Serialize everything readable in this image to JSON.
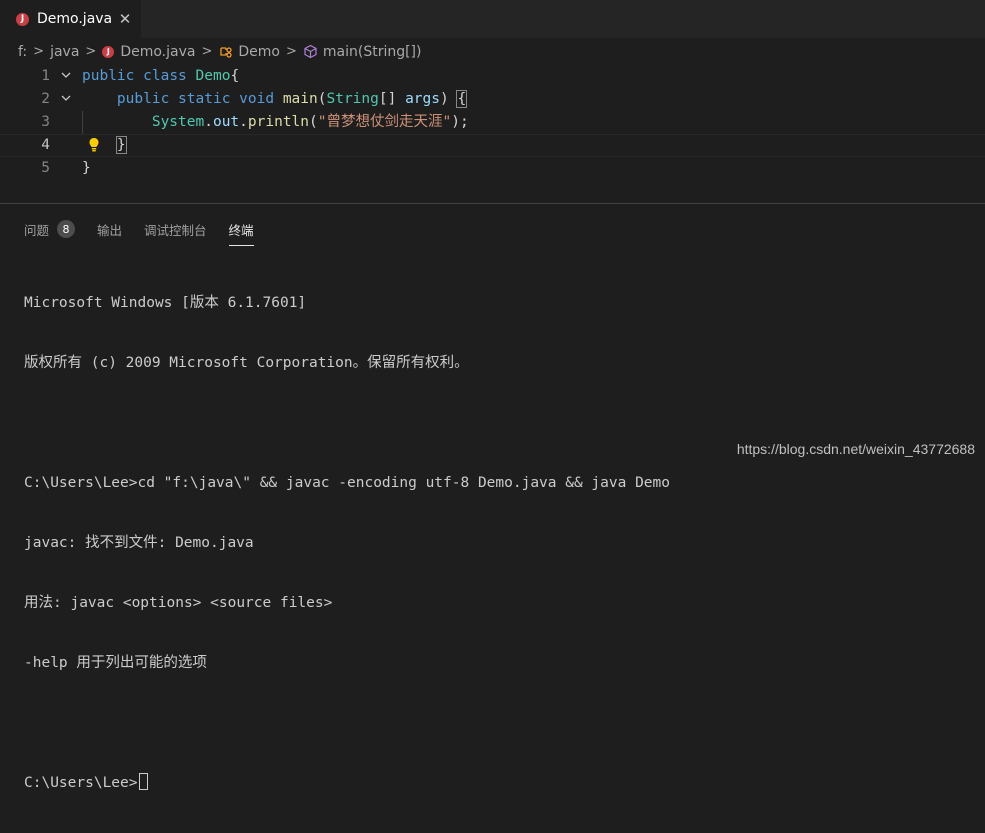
{
  "tab": {
    "filename": "Demo.java",
    "icon_letter": "J",
    "close_glyph": "✕"
  },
  "breadcrumb": {
    "drive": "f:",
    "folder": "java",
    "file": "Demo.java",
    "class": "Demo",
    "method": "main(String[])"
  },
  "editor": {
    "lines": [
      {
        "num": "1",
        "code_kw1": "public",
        "code_kw2": "class",
        "code_cls": "Demo",
        "code_brace": "{"
      },
      {
        "num": "2",
        "kw1": "public",
        "kw2": "static",
        "kw3": "void",
        "fn": "main",
        "p1": "(",
        "ty": "String",
        "p2": "[] ",
        "var": "args",
        "p3": ") ",
        "brace": "{"
      },
      {
        "num": "3",
        "cls": "System",
        "d1": ".",
        "field": "out",
        "d2": ".",
        "fn": "println",
        "p1": "(",
        "str": "\"曾梦想仗剑走天涯\"",
        "p2": ");"
      },
      {
        "num": "4",
        "brace": "}"
      },
      {
        "num": "5",
        "brace": "}"
      }
    ]
  },
  "panel": {
    "tabs": [
      {
        "label": "问题",
        "badge": "8"
      },
      {
        "label": "输出"
      },
      {
        "label": "调试控制台"
      },
      {
        "label": "终端"
      }
    ],
    "terminal_lines": [
      "Microsoft Windows [版本 6.1.7601]",
      "版权所有 (c) 2009 Microsoft Corporation。保留所有权利。",
      "",
      "C:\\Users\\Lee>cd \"f:\\java\\\" && javac -encoding utf-8 Demo.java && java Demo",
      "javac: 找不到文件: Demo.java",
      "用法: javac <options> <source files>",
      "-help 用于列出可能的选项",
      "",
      "C:\\Users\\Lee>"
    ]
  },
  "watermark": "https://blog.csdn.net/weixin_43772688",
  "colors": {
    "keyword": "#569cd6",
    "type": "#4ec9b0",
    "function": "#dcdcaa",
    "variable": "#9cdcfe",
    "string": "#ce9178",
    "java_icon": "#cc3e44"
  }
}
